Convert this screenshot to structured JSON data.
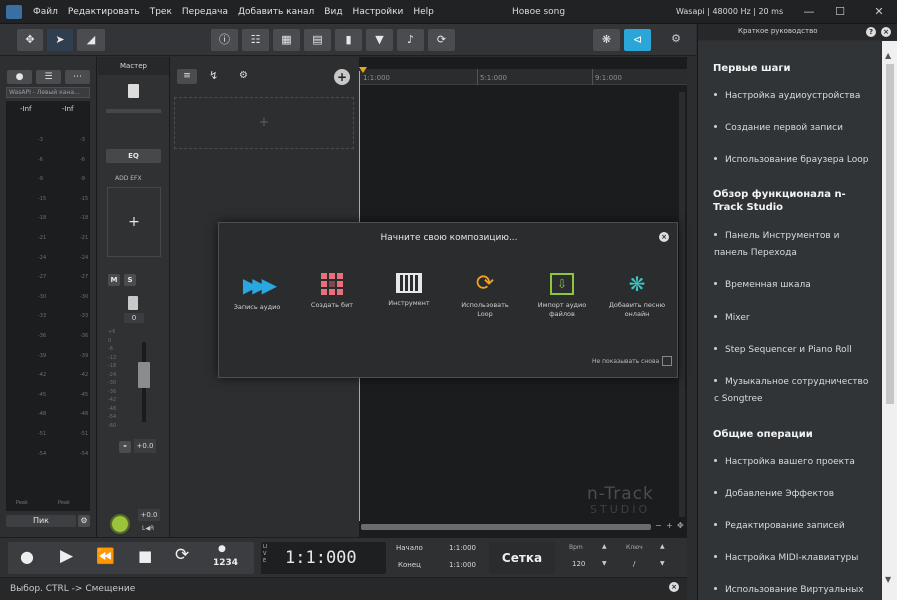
{
  "menu": {
    "file": "Файл",
    "edit": "Редактировать",
    "track": "Трек",
    "transfer": "Передача",
    "add_channel": "Добавить канал",
    "view": "Вид",
    "settings": "Настройки",
    "help": "Help"
  },
  "window": {
    "title": "Новое song",
    "audio_info": "Wasapi | 48000 Hz | 20 ms"
  },
  "left_panel": {
    "device": "WasAPI - Левый кана...",
    "meter_l": "-Inf",
    "meter_r": "-Inf",
    "peak_left": "Peak",
    "peak_right": "Peak",
    "peak_mode": "Пик",
    "scale": [
      "-3",
      "-6",
      "-9",
      "-15",
      "-18",
      "-21",
      "-24",
      "-27",
      "-30",
      "-33",
      "-36",
      "-39",
      "-42",
      "-45",
      "-48",
      "-51",
      "-54"
    ]
  },
  "master": {
    "label": "Мастер",
    "eq": "EQ",
    "add_efx": "ADD EFX",
    "plus": "+",
    "mute": "M",
    "solo": "S",
    "gain": "0",
    "pan": "+0.0",
    "volume": "+0.0",
    "lr": "L◀R",
    "fader_scale": [
      "+6",
      "0",
      "-6",
      "-12",
      "-18",
      "-24",
      "-30",
      "-36",
      "-42",
      "-48",
      "-54",
      "-60"
    ]
  },
  "tracks": {
    "add": "+"
  },
  "ruler": [
    "1:1:000",
    "5:1:000",
    "9:1:000"
  ],
  "watermark": {
    "line1": "n-Track",
    "line2": "STUDIO"
  },
  "dialog": {
    "title": "Начните свою композицию...",
    "options": [
      {
        "label": "Запись аудио",
        "color": "#2aa7e0"
      },
      {
        "label": "Создать бит",
        "color": "#e8707a"
      },
      {
        "label": "Инструмент",
        "color": "#e8e8e8"
      },
      {
        "label": "Использовать Loop",
        "color": "#f0a028"
      },
      {
        "label": "Импорт аудио файлов",
        "color": "#8cc63e"
      },
      {
        "label": "Добавить песню онлайн",
        "color": "#3ec5c0"
      }
    ],
    "dont_show": "Не показывать снова"
  },
  "transport": {
    "live": "LIVE",
    "position": "1:1:000",
    "start_label": "Начало",
    "start_value": "1:1:000",
    "end_label": "Конец",
    "end_value": "1:1:000",
    "grid": "Сетка",
    "bpm_label": "Bpm",
    "bpm_value": "120",
    "key_label": "Ключ",
    "key_value": "/",
    "count_in": "1234"
  },
  "status": {
    "text": "Выбор. CTRL -> Смещение"
  },
  "guide": {
    "title": "Краткое руководство",
    "sections": [
      {
        "heading": "Первые шаги",
        "items": [
          "Настройка аудиоустройства",
          "Создание первой записи",
          "Использование браузера Loop"
        ]
      },
      {
        "heading": "Обзор функционала n-Track Studio",
        "items": [
          "Панель Инструментов и панель Перехода",
          "Временная шкала",
          "Mixer",
          "Step Sequencer и Piano Roll",
          "Музыкальное сотрудничество с Songtree"
        ]
      },
      {
        "heading": "Общие операции",
        "items": [
          "Настройка вашего проекта",
          "Добавление Эффектов",
          "Редактирование записей",
          "Настройка MIDI-клавиатуры",
          "Использование Виртуальных"
        ]
      }
    ]
  }
}
